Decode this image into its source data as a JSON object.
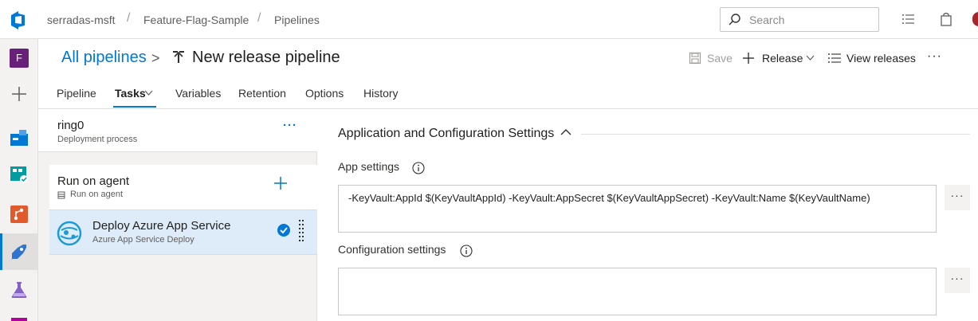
{
  "breadcrumb": {
    "org": "serradas-msft",
    "project": "Feature-Flag-Sample",
    "section": "Pipelines",
    "separator": "/"
  },
  "search": {
    "placeholder": "Search"
  },
  "rail": {
    "project_initial": "F"
  },
  "header": {
    "parent_link": "All pipelines",
    "title": "New release pipeline",
    "chevron": ">"
  },
  "actions": {
    "save": "Save",
    "release": "Release",
    "view_releases": "View releases",
    "more": "···"
  },
  "tabs": [
    {
      "label": "Pipeline"
    },
    {
      "label": "Tasks"
    },
    {
      "label": "Variables"
    },
    {
      "label": "Retention"
    },
    {
      "label": "Options"
    },
    {
      "label": "History"
    }
  ],
  "stage": {
    "name": "ring0",
    "subtitle": "Deployment process",
    "more": "···"
  },
  "agent_job": {
    "name": "Run on agent",
    "subtitle": "Run on agent"
  },
  "task": {
    "name": "Deploy Azure App Service",
    "subtitle": "Azure App Service Deploy"
  },
  "settings": {
    "section_title": "Application and Configuration Settings",
    "app_settings_label": "App settings",
    "app_settings_value": "-KeyVault:AppId $(KeyVaultAppId) -KeyVault:AppSecret $(KeyVaultAppSecret) -KeyVault:Name $(KeyVaultName)",
    "config_settings_label": "Configuration settings",
    "config_settings_value": "",
    "more": "···"
  },
  "colors": {
    "accent": "#0078d4",
    "selected_task_bg": "#deecf9",
    "project_badge": "#68217a"
  }
}
